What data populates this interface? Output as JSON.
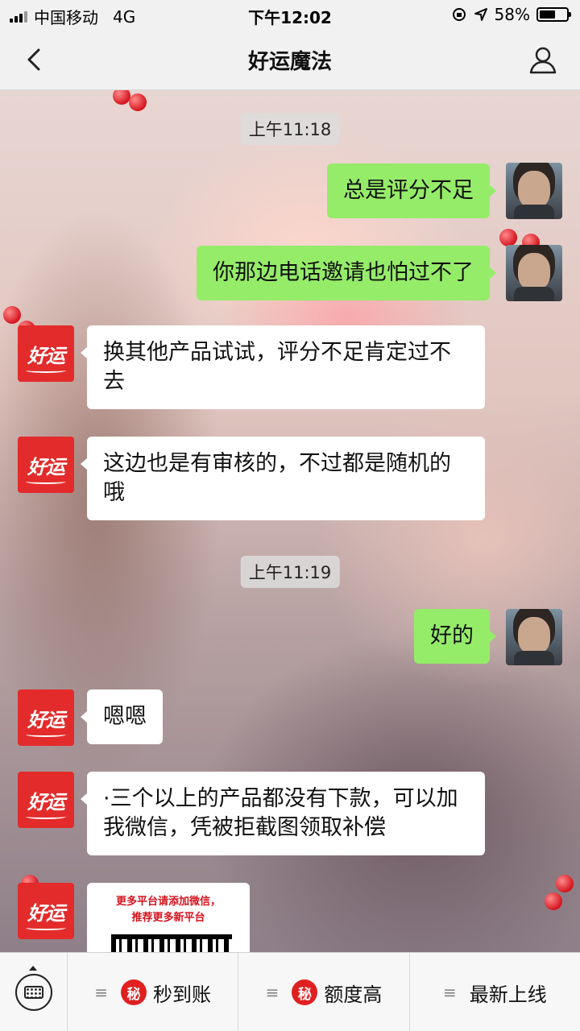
{
  "status_bar": {
    "carrier": "中国移动",
    "network": "4G",
    "time": "下午12:02",
    "battery": "58%",
    "battery_level": 0.58
  },
  "nav": {
    "title": "好运魔法",
    "back_icon": "chevron-left-icon",
    "profile_icon": "person-icon"
  },
  "chat": {
    "timestamps": [
      "上午11:18",
      "上午11:19"
    ],
    "messages": [
      {
        "side": "right",
        "text": "总是评分不足"
      },
      {
        "side": "right",
        "text": "你那边电话邀请也怕过不了"
      },
      {
        "side": "left",
        "text": "换其他产品试试，评分不足肯定过不去"
      },
      {
        "side": "left",
        "text": "这边也是有审核的，不过都是随机的哦"
      },
      {
        "side": "right",
        "text": "好的"
      },
      {
        "side": "left",
        "text": "嗯嗯"
      },
      {
        "side": "left",
        "text": "·三个以上的产品都没有下款，可以加我微信，凭被拒截图领取补偿"
      }
    ],
    "brand_logo": "好运",
    "image_message": {
      "line1": "更多平台请添加微信，",
      "line2": "推荐更多新平台"
    }
  },
  "bottom_menu": {
    "keyboard_icon": "keyboard-icon",
    "items": [
      {
        "badge": "秘",
        "label": "秒到账"
      },
      {
        "badge": "秘",
        "label": "额度高"
      },
      {
        "badge": "",
        "label": "最新上线"
      }
    ],
    "menu_icon": "≡"
  }
}
